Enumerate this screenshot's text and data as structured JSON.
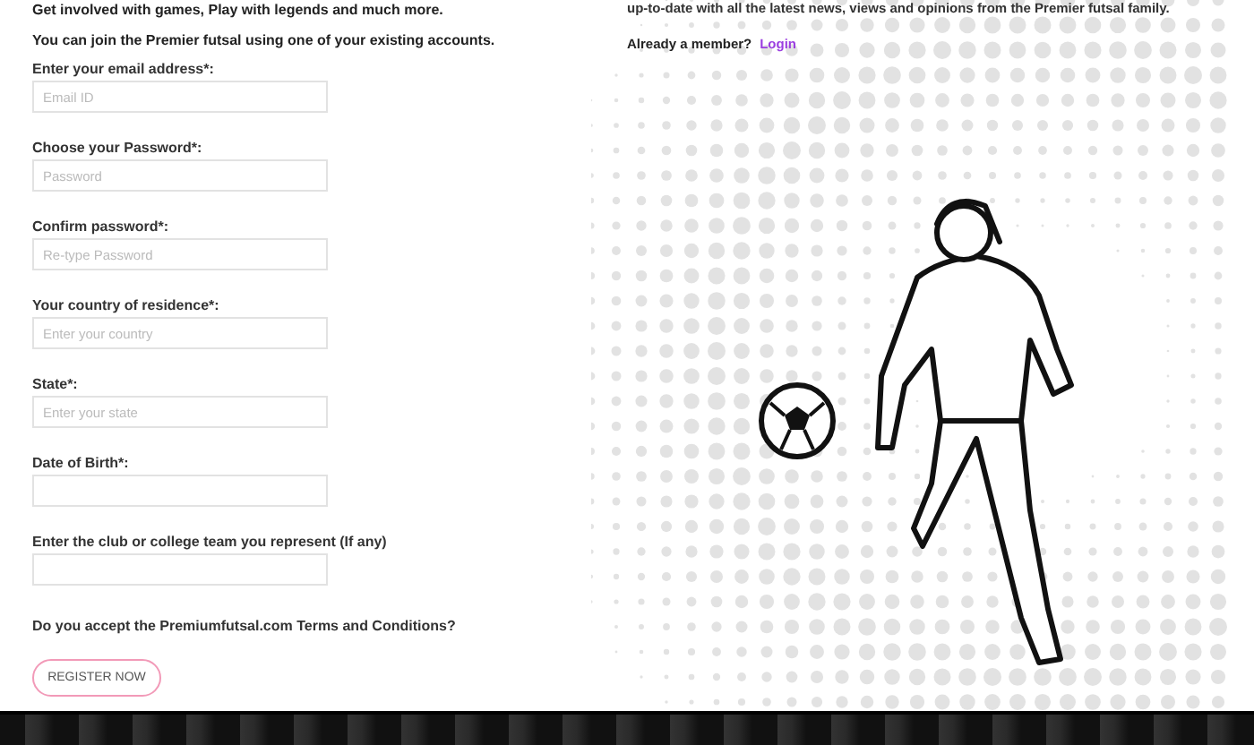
{
  "intro": {
    "tagline": "Get involved with games, Play with legends and much more.",
    "join_note": "You can join the Premier futsal using one of your existing accounts."
  },
  "form": {
    "fields": [
      {
        "label": "Enter your email address*:",
        "placeholder": "Email ID"
      },
      {
        "label": "Choose your Password*:",
        "placeholder": "Password"
      },
      {
        "label": "Confirm password*:",
        "placeholder": "Re-type Password"
      },
      {
        "label": "Your country of residence*:",
        "placeholder": "Enter your country"
      },
      {
        "label": "State*:",
        "placeholder": "Enter your state"
      },
      {
        "label": "Date of Birth*:"
      },
      {
        "label": "Enter the club or college team you represent (If any)"
      }
    ],
    "terms_question": "Do you accept the Premiumfutsal.com Terms and Conditions?",
    "submit_button": "REGISTER NOW"
  },
  "side": {
    "blurb": "up-to-date with all the latest news, views and opinions from the Premier futsal family.",
    "member_prompt": "Already a member?",
    "login_link": "Login"
  }
}
